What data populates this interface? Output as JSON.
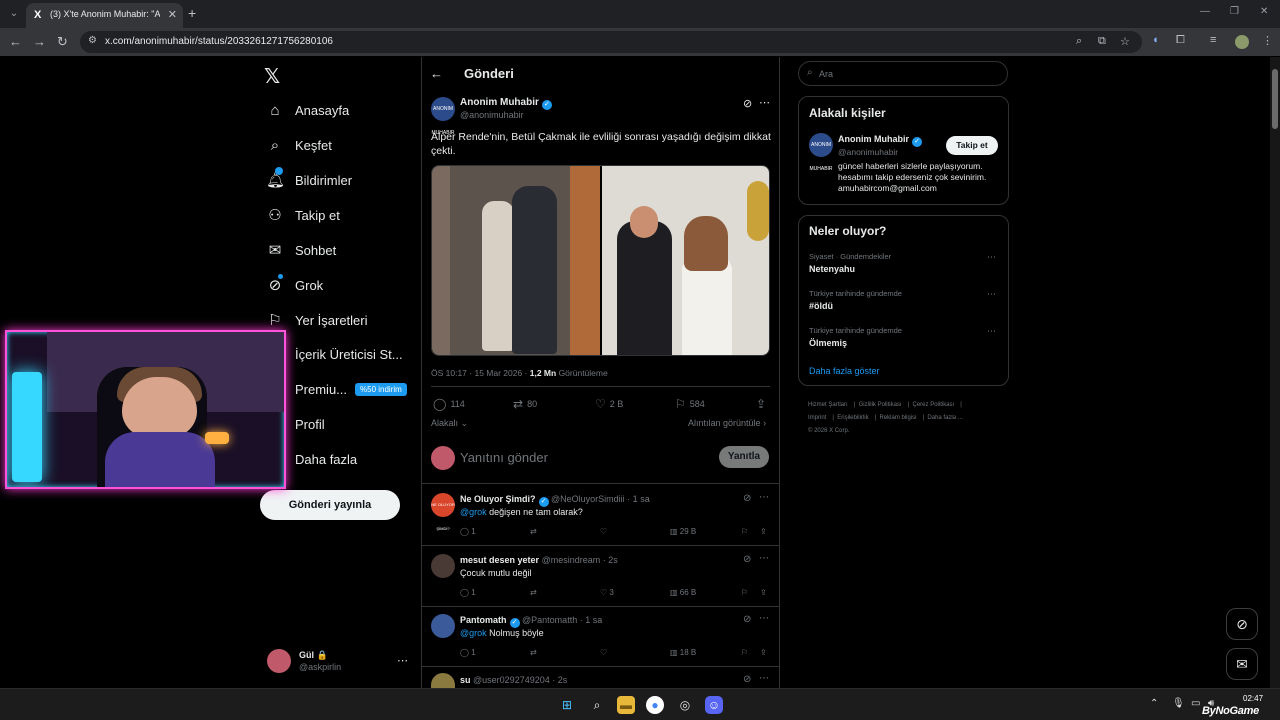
{
  "browser": {
    "tab_title": "(3) X'te Anonim Muhabir: \"Alpe",
    "url": "x.com/anonimuhabir/status/2033261271756280106",
    "tab_favicon": "X"
  },
  "nav": {
    "items": [
      {
        "label": "Anasayfa",
        "icon": "home-icon"
      },
      {
        "label": "Keşfet",
        "icon": "search-icon"
      },
      {
        "label": "Bildirimler",
        "icon": "bell-icon"
      },
      {
        "label": "Takip et",
        "icon": "add-person-icon"
      },
      {
        "label": "Sohbet",
        "icon": "mail-icon"
      },
      {
        "label": "Grok",
        "icon": "grok-icon"
      },
      {
        "label": "Yer İşaretleri",
        "icon": "bookmark-icon"
      },
      {
        "label": "İçerik Üreticisi St...",
        "icon": "creator-icon"
      },
      {
        "label": "Premiu...",
        "icon": "premium-icon"
      },
      {
        "label": "Profil",
        "icon": "profile-icon"
      },
      {
        "label": "Daha fazla",
        "icon": "more-icon"
      }
    ],
    "premium_badge": "%50 indirim",
    "post_button": "Gönderi yayınla",
    "me": {
      "name": "Gül 🔒",
      "handle": "@askpirlin"
    }
  },
  "header": {
    "title": "Gönderi"
  },
  "post": {
    "author_name": "Anonim Muhabir",
    "author_handle": "@anonimuhabir",
    "avatar_text": "ANONIM MUHABIR",
    "text": "Alper Rende'nin, Betül Çakmak ile evliliği sonrası yaşadığı değişim dikkat çekti.",
    "time": "ÖS 10:17 · 15 Mar 2026 · ",
    "views_value": "1,2 Mn",
    "views_label": " Görüntüleme",
    "stats": {
      "replies": "114",
      "reposts": "80",
      "likes": "2 B",
      "bookmarks": "584"
    },
    "relevant_label": "Alakalı",
    "quotes_label": "Alıntılan görüntüle"
  },
  "reply_box": {
    "placeholder": "Yanıtını gönder",
    "button": "Yanıtla"
  },
  "comments": [
    {
      "name": "Ne Oluyor Şimdi?",
      "verified": true,
      "handle": "@NeOluyorSimdiii · 1 sa",
      "mention": "@grok",
      "text": " değişen ne tam olarak?",
      "replies": "1",
      "likes": "",
      "views": "29 B",
      "avatar_color": "#d9462b",
      "avatar_text": "NE OLUYOR ŞİMDİ?"
    },
    {
      "name": "mesut desen yeter",
      "verified": false,
      "handle": "@mesindream · 2s",
      "mention": "",
      "text": "Çocuk mutlu değil",
      "replies": "1",
      "likes": "3",
      "views": "66 B",
      "avatar_color": "#4a3a35",
      "avatar_text": ""
    },
    {
      "name": "Pantomath",
      "verified": true,
      "handle": "@Pantomatth · 1 sa",
      "mention": "@grok",
      "text": " Nolmuş böyle",
      "replies": "1",
      "likes": "",
      "views": "18 B",
      "avatar_color": "#3a5a9a",
      "avatar_text": ""
    },
    {
      "name": "su",
      "verified": false,
      "handle": "@user0292749204 · 2s",
      "mention": "",
      "text": "",
      "replies": "",
      "likes": "",
      "views": "",
      "avatar_color": "#8a7a40",
      "avatar_text": ""
    }
  ],
  "search": {
    "placeholder": "Ara"
  },
  "who_to_follow": {
    "title": "Alakalı kişiler",
    "name": "Anonim Muhabir",
    "handle": "@anonimuhabir",
    "follow": "Takip et",
    "bio": "güncel haberleri sizlerle paylaşıyorum. hesabımı takip ederseniz çok sevinirim. amuhabircom@gmail.com"
  },
  "trends": {
    "title": "Neler oluyor?",
    "items": [
      {
        "category": "Siyaset · Gündemdekiler",
        "name": "Netenyahu"
      },
      {
        "category": "Türkiye tarihinde gündemde",
        "name": "#öldü"
      },
      {
        "category": "Türkiye tarihinde gündemde",
        "name": "Ölmemiş"
      }
    ],
    "show_more": "Daha fazla göster"
  },
  "footer": {
    "links": [
      "Hizmet Şartları",
      "Gizlilik Politikası",
      "Çerez Politikası",
      "Imprint",
      "Erişilebilirlik",
      "Reklam bilgisi",
      "Daha fazla ...",
      "© 2026 X Corp."
    ]
  },
  "taskbar": {
    "time": "02:47",
    "watermark": "ByNoGame"
  },
  "colors": {
    "accent": "#1d9bf0",
    "background": "#000000",
    "webcam_border": "#ff54d9"
  }
}
